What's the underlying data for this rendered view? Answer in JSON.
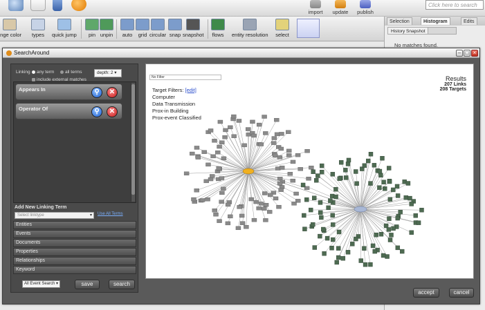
{
  "top": {
    "import_label": "import",
    "update_label": "update",
    "publish_label": "publish",
    "search_placeholder": "Click here to search"
  },
  "toolbar": {
    "items": [
      {
        "label": "ange color",
        "icon": "change-color-icon"
      },
      {
        "label": "types",
        "icon": "types-icon"
      },
      {
        "label": "quick jump",
        "icon": "quick-jump-icon"
      },
      {
        "label": "pin",
        "icon": "pin-icon"
      },
      {
        "label": "unpin",
        "icon": "unpin-icon"
      },
      {
        "label": "auto",
        "icon": "auto-layout-icon"
      },
      {
        "label": "grid",
        "icon": "grid-layout-icon"
      },
      {
        "label": "circular",
        "icon": "circular-layout-icon"
      },
      {
        "label": "snap",
        "icon": "snap-icon"
      },
      {
        "label": "snapshot",
        "icon": "snapshot-icon"
      },
      {
        "label": "flows",
        "icon": "flows-icon"
      },
      {
        "label": "entity resolution",
        "icon": "entity-resolution-icon"
      },
      {
        "label": "select",
        "icon": "select-icon"
      }
    ]
  },
  "right_panel": {
    "tabs": [
      "Selection",
      "Histogram",
      "Edits"
    ],
    "active_tab": "Histogram",
    "sub_button": "History Snapshot",
    "no_matches": "No matches found."
  },
  "dialog": {
    "title": "SearchAround",
    "linking_label": "Linking",
    "opt_any_term": "any term",
    "opt_all_terms": "all terms",
    "opt_external": "include external matches",
    "depth_value": "depth: 2",
    "terms": [
      {
        "label": "Appears In"
      },
      {
        "label": "Operator Of"
      }
    ],
    "add_term_label": "Add New Linking Term",
    "add_term_select": "Select linktype",
    "add_term_link": "Use All Terms",
    "accordions": [
      "Entities",
      "Events",
      "Documents",
      "Properties",
      "Relationships",
      "Keyword"
    ],
    "search_type": "All Event Search",
    "save_label": "save",
    "search_label": "search",
    "accept_label": "accept",
    "cancel_label": "cancel"
  },
  "graph": {
    "filter_value": "No Filter",
    "target_filters_label": "Target Filters:",
    "edit_label": "[edit]",
    "target_filter_items": [
      "Computer",
      "Data Transmission",
      "Prox-in Building",
      "Prox-event Classified"
    ],
    "results_title": "Results",
    "results_links": "207 Links",
    "results_targets": "208 Targets",
    "left_cluster_color": "#8a8a8a",
    "left_hub_color": "#f0b020",
    "right_cluster_color": "#4e6b52",
    "right_hub_color": "#a9b8d6"
  }
}
